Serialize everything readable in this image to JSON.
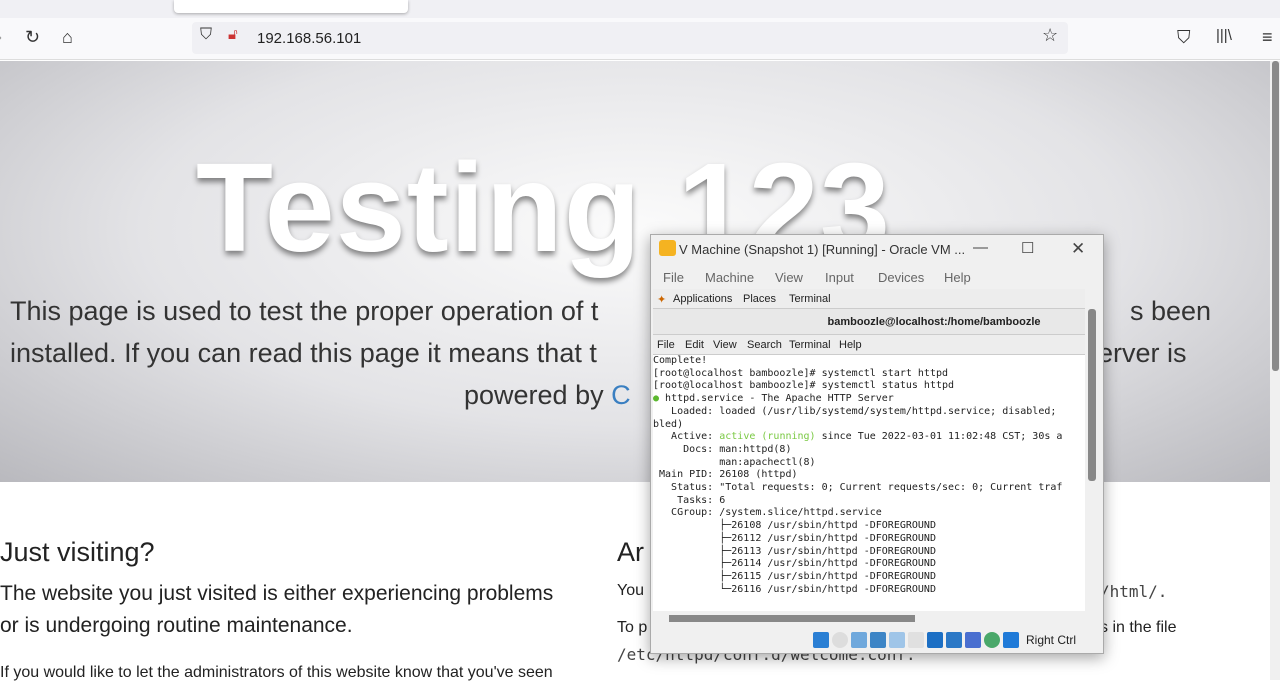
{
  "browser": {
    "url": "192.168.56.101",
    "icons": [
      "back-icon",
      "reload-icon",
      "home-icon",
      "shield-icon",
      "insecure-lock-icon",
      "bookmark-star-icon",
      "pocket-icon",
      "library-icon",
      "menu-icon"
    ]
  },
  "page": {
    "hero_title": "Testing 123",
    "hero_line1_left": "This page is used to test the proper operation of t",
    "hero_line1_right": "s been",
    "hero_line2_left": "installed. If you can read this page it means that t",
    "hero_line2_right": "erver is",
    "hero_line3_left": "powered by ",
    "hero_line3_link": "C",
    "visiting_heading": "Just visiting?",
    "visiting_p1_line1": "The website you just visited is either experiencing problems",
    "visiting_p1_line2": "or is undergoing routine maintenance.",
    "visiting_p2": "If you would like to let the administrators of this website know that you've seen",
    "admin_heading": "Ar",
    "admin_p1_left": "You",
    "admin_p1_right": "/html/.",
    "admin_p2_left": "To p",
    "admin_p2_right": "s in the file",
    "admin_p2_code": "/etc/httpd/conf.d/welcome.conf."
  },
  "vm": {
    "title": "V Machine (Snapshot 1) [Running] - Oracle VM ...",
    "menu": [
      "File",
      "Machine",
      "View",
      "Input",
      "Devices",
      "Help"
    ],
    "gnome_menu": [
      "Applications",
      "Places",
      "Terminal"
    ],
    "terminal_title": "bamboozle@localhost:/home/bamboozle",
    "terminal_menu": [
      "File",
      "Edit",
      "View",
      "Search",
      "Terminal",
      "Help"
    ],
    "lines": [
      "Complete!",
      "[root@localhost bamboozle]# systemctl start httpd",
      "[root@localhost bamboozle]# systemctl status httpd",
      " httpd.service - The Apache HTTP Server",
      "   Loaded: loaded (/usr/lib/systemd/system/httpd.service; disabled;",
      "bled)",
      "   Active: ",
      "     Docs: man:httpd(8)",
      "           man:apachectl(8)",
      " Main PID: 26108 (httpd)",
      "   Status: \"Total requests: 0; Current requests/sec: 0; Current traf",
      "    Tasks: 6",
      "   CGroup: /system.slice/httpd.service",
      "           ├─26108 /usr/sbin/httpd -DFOREGROUND",
      "           ├─26112 /usr/sbin/httpd -DFOREGROUND",
      "           ├─26113 /usr/sbin/httpd -DFOREGROUND",
      "           ├─26114 /usr/sbin/httpd -DFOREGROUND",
      "           ├─26115 /usr/sbin/httpd -DFOREGROUND",
      "           └─26116 /usr/sbin/httpd -DFOREGROUND"
    ],
    "active_state": "active (running)",
    "active_rest": " since Tue 2022-03-01 11:02:48 CST; 30s a",
    "host_key": "Right Ctrl",
    "colors": {
      "active": "#7ac943"
    }
  }
}
